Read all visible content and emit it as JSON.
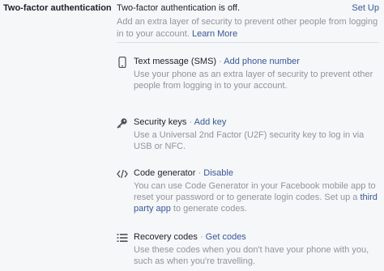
{
  "section": {
    "label": "Two-factor authentication"
  },
  "status": {
    "text": "Two-factor authentication is off.",
    "action": "Set Up"
  },
  "intro": {
    "text": "Add an extra layer of security to prevent other people from logging in to your account.",
    "link": "Learn More"
  },
  "separator": "·",
  "methods": [
    {
      "title": "Text message (SMS)",
      "action": "Add phone number",
      "desc": "Use your phone as an extra layer of security to prevent other people from logging in to your account.",
      "icon": "phone-icon"
    },
    {
      "title": "Security keys",
      "action": "Add key",
      "desc": "Use a Universal 2nd Factor (U2F) security key to log in via USB or NFC.",
      "icon": "key-icon"
    },
    {
      "title": "Code generator",
      "action": "Disable",
      "desc_before": "You can use Code Generator in your Facebook mobile app to reset your password or to generate login codes. Set up a ",
      "desc_link": "third party app",
      "desc_after": " to generate codes.",
      "icon": "code-icon"
    },
    {
      "title": "Recovery codes",
      "action": "Get codes",
      "desc": "Use these codes when you don't have your phone with you, such as when you're travelling.",
      "icon": "list-icon"
    }
  ],
  "colors": {
    "link": "#365899",
    "muted": "#90949c",
    "text": "#1d2129",
    "background": "#f6f7f9"
  }
}
